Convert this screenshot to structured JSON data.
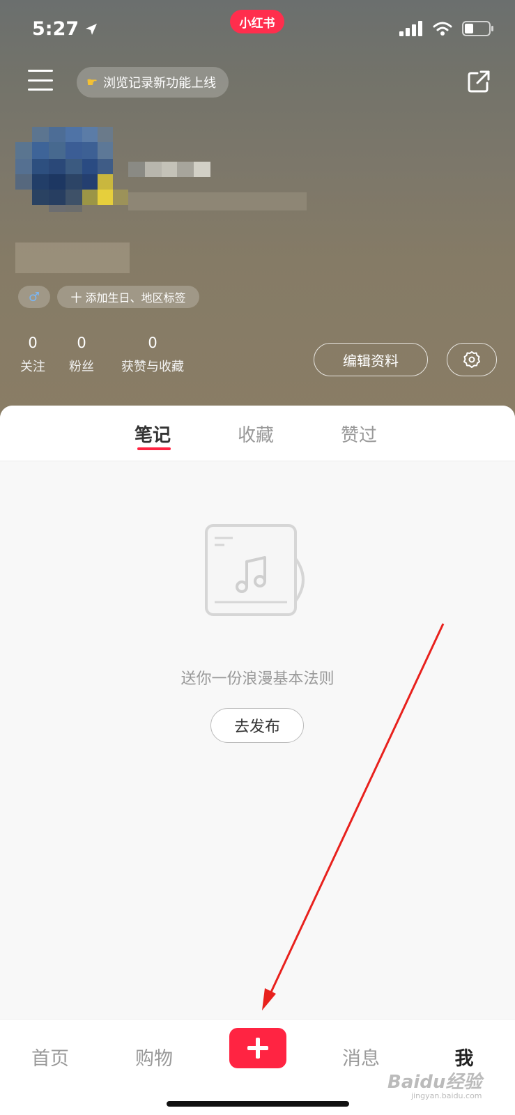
{
  "status_bar": {
    "time": "5:27",
    "app_badge": "小红书"
  },
  "header": {
    "history_pill": "浏览记录新功能上线",
    "gender_icon": "male-icon",
    "add_tag_label": "十 添加生日、地区标签"
  },
  "stats": [
    {
      "value": "0",
      "label": "关注"
    },
    {
      "value": "0",
      "label": "粉丝"
    },
    {
      "value": "0",
      "label": "获赞与收藏"
    }
  ],
  "profile_actions": {
    "edit_label": "编辑资料"
  },
  "tabs": [
    {
      "label": "笔记",
      "active": true
    },
    {
      "label": "收藏",
      "active": false
    },
    {
      "label": "赞过",
      "active": false
    }
  ],
  "empty_state": {
    "message": "送你一份浪漫基本法则",
    "publish_label": "去发布"
  },
  "bottom_nav": [
    {
      "label": "首页"
    },
    {
      "label": "购物"
    },
    {
      "label": "消息"
    },
    {
      "label": "我"
    }
  ],
  "watermark": {
    "brand": "Baidu经验",
    "sub": "jingyan.baidu.com"
  },
  "colors": {
    "accent": "#ff2442",
    "annotation_arrow": "#e8211d"
  }
}
